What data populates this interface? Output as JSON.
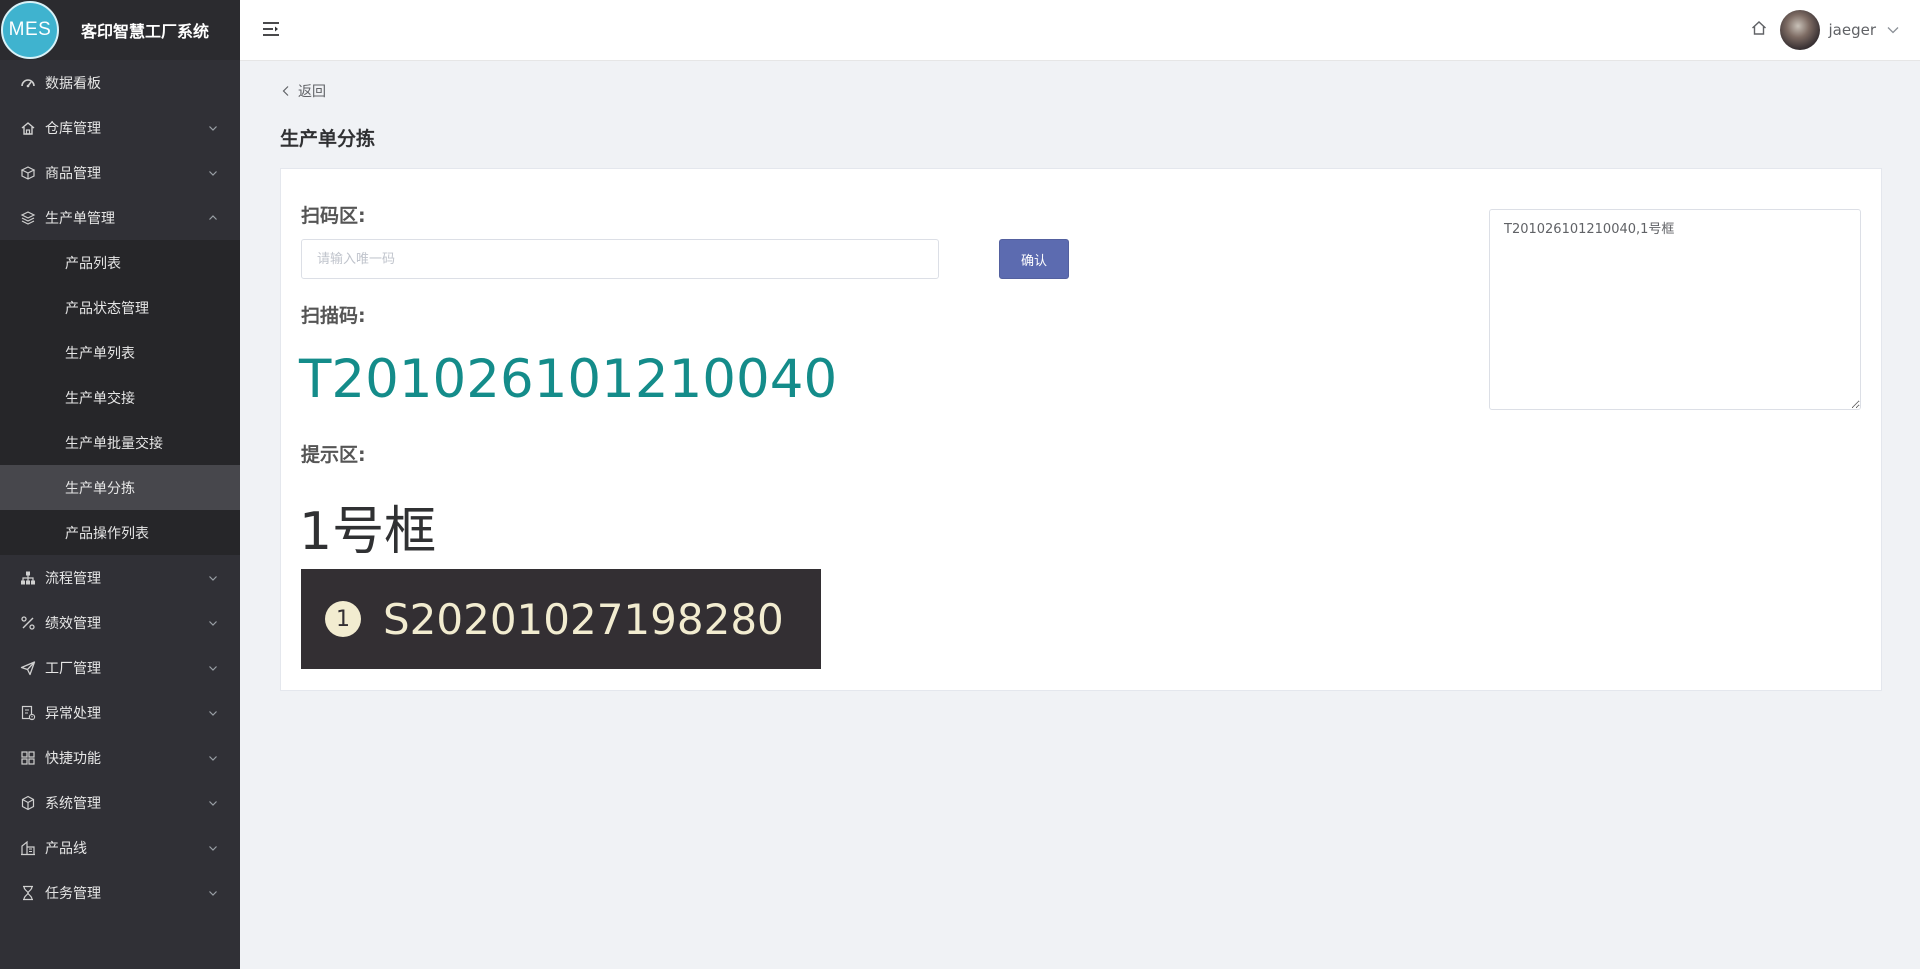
{
  "app": {
    "logo_text": "MES",
    "title": "客印智慧工厂系统"
  },
  "sidebar": {
    "items": [
      {
        "label": "数据看板",
        "icon": "dashboard-icon"
      },
      {
        "label": "仓库管理",
        "icon": "home-icon"
      },
      {
        "label": "商品管理",
        "icon": "box-icon"
      },
      {
        "label": "生产单管理",
        "icon": "layers-icon"
      },
      {
        "label": "流程管理",
        "icon": "sitemap-icon"
      },
      {
        "label": "绩效管理",
        "icon": "percent-icon"
      },
      {
        "label": "工厂管理",
        "icon": "send-icon"
      },
      {
        "label": "异常处理",
        "icon": "warning-doc-icon"
      },
      {
        "label": "快捷功能",
        "icon": "grid-icon"
      },
      {
        "label": "系统管理",
        "icon": "cube-icon"
      },
      {
        "label": "产品线",
        "icon": "building-icon"
      },
      {
        "label": "任务管理",
        "icon": "hourglass-icon"
      }
    ],
    "submenu": [
      {
        "label": "产品列表"
      },
      {
        "label": "产品状态管理"
      },
      {
        "label": "生产单列表"
      },
      {
        "label": "生产单交接"
      },
      {
        "label": "生产单批量交接"
      },
      {
        "label": "生产单分拣"
      },
      {
        "label": "产品操作列表"
      }
    ]
  },
  "header": {
    "username": "jaeger"
  },
  "main": {
    "back_label": "返回",
    "page_title": "生产单分拣",
    "scan_label": "扫码区:",
    "scan_placeholder": "请输入唯一码",
    "confirm_label": "确认",
    "code_label": "扫描码:",
    "scanned_code": "T201026101210040",
    "hint_label": "提示区:",
    "hint_value": "1号框",
    "sort_badge": "1",
    "sort_code": "S20201027198280",
    "log_text": "T201026101210040,1号框"
  },
  "colors": {
    "sidebar_bg": "#303036",
    "accent_button": "#5c6bb0",
    "scanned_code_color": "#148c8a",
    "sort_box_bg": "#332f33",
    "sort_text": "#f2ecd0"
  }
}
